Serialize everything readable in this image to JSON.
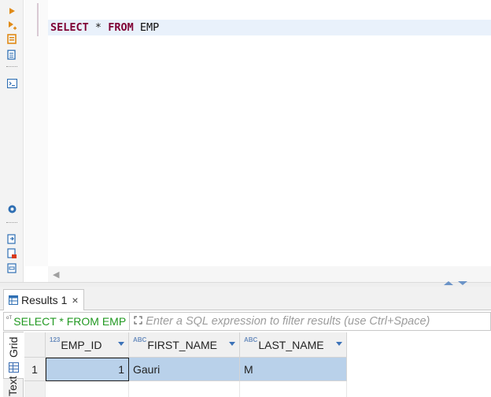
{
  "editor": {
    "sql": {
      "kw1": "SELECT",
      "star": "*",
      "kw2": "FROM",
      "table": "EMP"
    },
    "toolbar_icons": [
      "execute-statement-icon",
      "execute-script-icon",
      "explain-plan-icon",
      "load-plan-icon",
      "terminal-icon",
      "settings-icon",
      "export-icon",
      "lock-icon",
      "outline-icon"
    ]
  },
  "results": {
    "tab_label": "Results 1",
    "tab_close": "×",
    "filter": {
      "query_text": "SELECT * FROM EMP",
      "query_icon_text": "ᵒᵀ",
      "placeholder": "Enter a SQL expression to filter results (use Ctrl+Space)"
    },
    "view_tabs": {
      "grid": "Grid",
      "text": "Text"
    },
    "columns": [
      {
        "type_prefix": "123",
        "name": "EMP_ID"
      },
      {
        "type_prefix": "ABC",
        "name": "FIRST_NAME"
      },
      {
        "type_prefix": "ABC",
        "name": "LAST_NAME"
      }
    ],
    "rows": [
      {
        "num": "1",
        "EMP_ID": "1",
        "FIRST_NAME": "Gauri",
        "LAST_NAME": "M"
      }
    ]
  },
  "colors": {
    "keyword": "#7f0034",
    "filter_query": "#229922",
    "selected_row": "#b9d1ea"
  }
}
